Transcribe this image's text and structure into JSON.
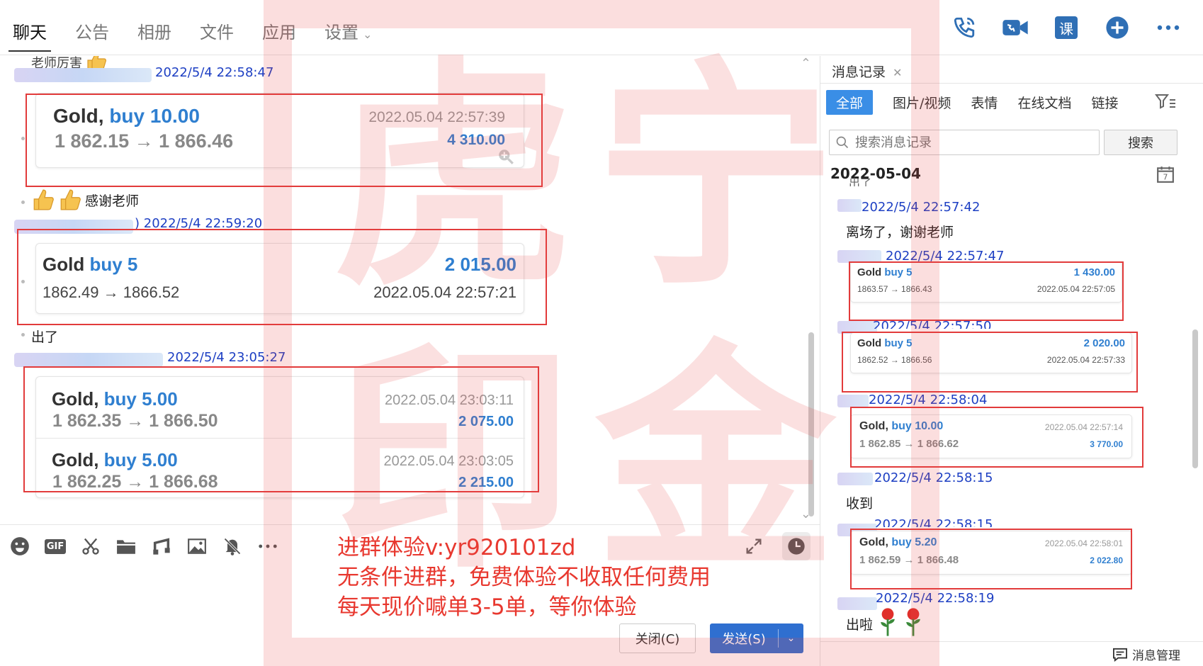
{
  "nav": {
    "tabs": [
      "聊天",
      "公告",
      "相册",
      "文件",
      "应用",
      "设置"
    ],
    "icons": [
      "phone-icon",
      "video-icon",
      "course-icon",
      "add-circle-icon",
      "more-icon"
    ],
    "course_label": "课"
  },
  "chat": {
    "partial_top_text": "老师厉害",
    "messages": {
      "m1_time": "2022/5/4 22:58:47",
      "m2_text": "感谢老师",
      "m3_time": "2022/5/4 22:59:20",
      "m3_prefix": ")",
      "m4_text": "出了",
      "m5_time": "2022/5/4 23:05:27"
    },
    "cards": {
      "c1": {
        "symbol": "Gold,",
        "side": "buy 10.00",
        "path": "1 862.15 → 1 866.46",
        "time": "2022.05.04 22:57:39",
        "profit": "4 310.00"
      },
      "c2": {
        "symbol": "Gold",
        "side": "buy 5",
        "path": "1862.49 → 1866.52",
        "time": "2022.05.04 22:57:21",
        "profit": "2 015.00"
      },
      "c3a": {
        "symbol": "Gold,",
        "side": "buy 5.00",
        "path": "1 862.35 → 1 866.50",
        "time": "2022.05.04 23:03:11",
        "profit": "2 075.00"
      },
      "c3b": {
        "symbol": "Gold,",
        "side": "buy 5.00",
        "path": "1 862.25 → 1 866.68",
        "time": "2022.05.04 23:03:05",
        "profit": "2 215.00"
      }
    }
  },
  "toolbar": {
    "icons": [
      "emoji-icon",
      "gif-icon",
      "scissors-icon",
      "folder-icon",
      "music-icon",
      "image-icon",
      "mute-icon",
      "more-icon"
    ],
    "gif_label": "GIF"
  },
  "promo": {
    "line1": "进群体验v:yr920101zd",
    "line2": "无条件进群，免费体验不收取任何费用",
    "line3": "每天现价喊单3-5单，等你体验"
  },
  "buttons": {
    "close": "关闭(C)",
    "send": "发送(S)"
  },
  "side": {
    "tab_label": "消息记录",
    "filters": [
      "全部",
      "图片/视频",
      "表情",
      "在线文档",
      "链接"
    ],
    "search_placeholder": "搜索消息记录",
    "search_button": "搜索",
    "date": "2022-05-04",
    "cal_day": "7",
    "partial_top": "出了",
    "entries": {
      "t1": "2022/5/4 22:57:42",
      "x1": "离场了，谢谢老师",
      "t2": "2022/5/4 22:57:47",
      "t3": "2022/5/4 22:57:50",
      "t4": "2022/5/4 22:58:04",
      "t5": "2022/5/4 22:58:15",
      "x5": "收到",
      "t6": "2022/5/4 22:58:15",
      "t7": "2022/5/4 22:58:19",
      "x7": "出啦"
    },
    "cards": {
      "s1": {
        "symbol": "Gold",
        "side": "buy 5",
        "path": "1863.57 → 1866.43",
        "time": "2022.05.04 22:57:05",
        "profit": "1 430.00"
      },
      "s2": {
        "symbol": "Gold",
        "side": "buy 5",
        "path": "1862.52 → 1866.56",
        "time": "2022.05.04 22:57:33",
        "profit": "2 020.00"
      },
      "s3": {
        "symbol": "Gold,",
        "side": "buy 10.00",
        "path": "1 862.85 → 1 866.62",
        "time": "2022.05.04 22:57:14",
        "profit": "3 770.00"
      },
      "s4": {
        "symbol": "Gold,",
        "side": "buy 5.20",
        "path": "1 862.59 → 1 866.48",
        "time": "2022.05.04 22:58:01",
        "profit": "2 022.80"
      }
    },
    "manage_label": "消息管理"
  },
  "watermark": {
    "chars": [
      "虎",
      "宁",
      "印",
      "金"
    ]
  },
  "colors": {
    "accent": "#2f6fd0",
    "highlight_box": "#e23b3b",
    "promo": "#e8382f",
    "timestamp": "#1d3fc3",
    "profit": "#2f7fd0"
  }
}
